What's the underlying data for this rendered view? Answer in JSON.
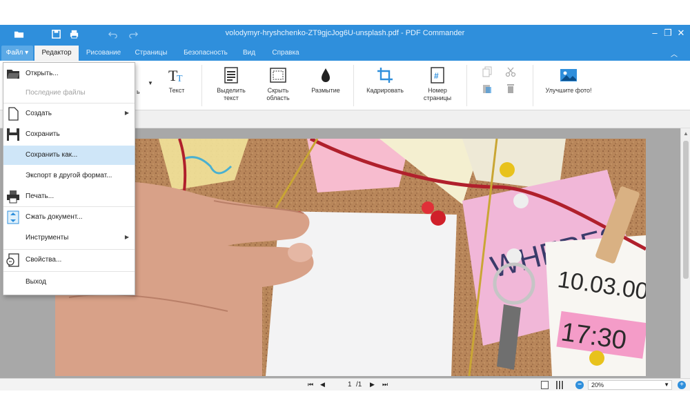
{
  "window": {
    "title": "volodymyr-hryshchenko-ZT9gjcJog6U-unsplash.pdf - PDF Commander"
  },
  "quick_access": [
    "folder-icon",
    "save-icon",
    "print-icon",
    "undo-icon",
    "redo-icon"
  ],
  "menu_tabs": [
    {
      "label": "Файл ▾",
      "state": "open"
    },
    {
      "label": "Редактор",
      "state": "active"
    },
    {
      "label": "Рисование"
    },
    {
      "label": "Страницы"
    },
    {
      "label": "Безопасность"
    },
    {
      "label": "Вид"
    },
    {
      "label": "Справка"
    }
  ],
  "ribbon": {
    "partial_label": "ь",
    "tools": [
      {
        "icon": "text-icon",
        "label": "Текст"
      },
      {
        "icon": "highlight-text-icon",
        "label": "Выделить\nтекст"
      },
      {
        "icon": "hide-area-icon",
        "label": "Скрыть\nобласть"
      },
      {
        "icon": "blur-icon",
        "label": "Размытие"
      },
      {
        "icon": "crop-icon",
        "label": "Кадрировать"
      },
      {
        "icon": "page-number-icon",
        "label": "Номер\nстраницы"
      },
      {
        "icon": "enhance-photo-icon",
        "label": "Улучшите фото!"
      }
    ]
  },
  "file_menu": {
    "items": [
      {
        "label": "Открыть...",
        "icon": "open-folder-icon"
      },
      {
        "label": "Последние файлы",
        "disabled": true
      },
      {
        "label": "Создать",
        "icon": "new-document-icon",
        "submenu": true
      },
      {
        "label": "Сохранить",
        "icon": "save-icon"
      },
      {
        "label": "Сохранить как...",
        "highlighted": true
      },
      {
        "label": "Экспорт в другой формат..."
      },
      {
        "label": "Печать...",
        "icon": "printer-icon"
      },
      {
        "label": "Сжать документ...",
        "icon": "compress-icon"
      },
      {
        "label": "Инструменты",
        "submenu": true
      },
      {
        "label": "Свойства...",
        "icon": "properties-icon"
      },
      {
        "label": "Выход"
      }
    ]
  },
  "photo_text": {
    "note1": "WHERE?",
    "date": "10.03.00",
    "time": "17:30"
  },
  "pager": {
    "current": "1",
    "total": "/1"
  },
  "zoom": {
    "value": "20%"
  },
  "colors": {
    "accent": "#2f8fdc",
    "menu_highlight": "#cfe6f8"
  }
}
